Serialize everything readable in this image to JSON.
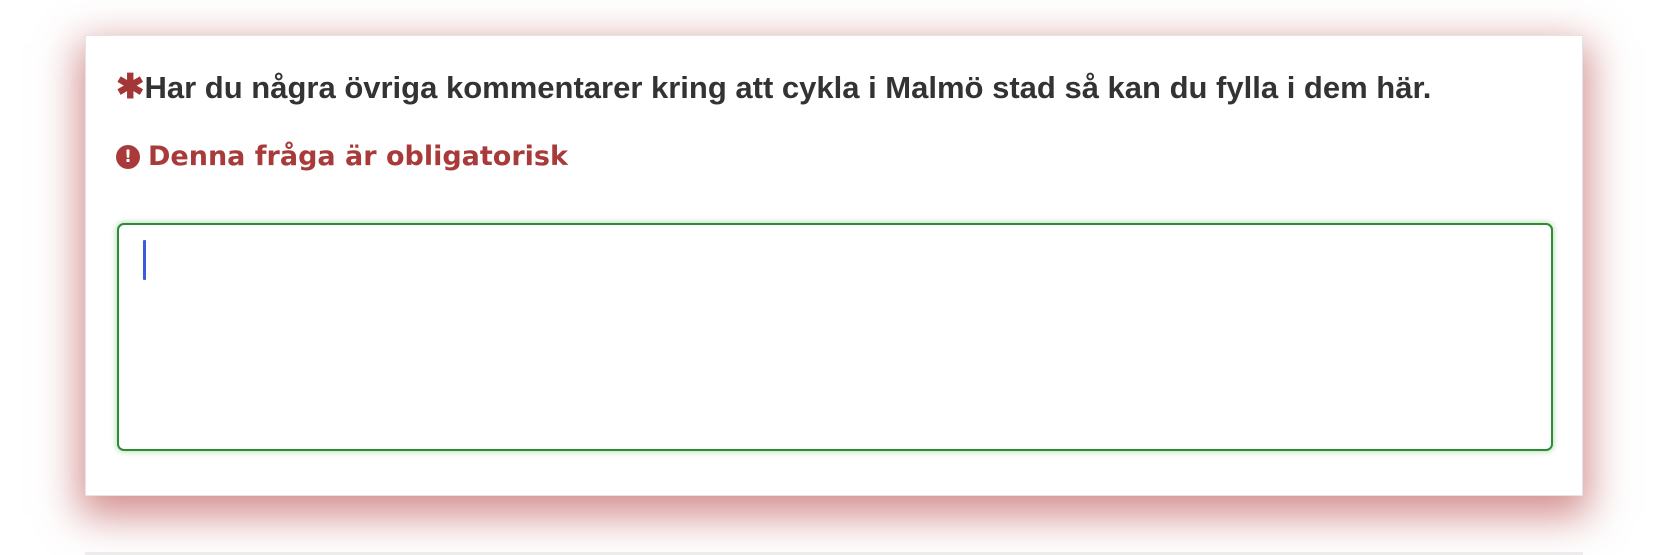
{
  "question": {
    "required_marker": "✱",
    "text": "Har du några övriga kommentarer kring att cykla i Malmö stad så kan du fylla i dem här."
  },
  "validation": {
    "icon": "exclamation-circle-icon",
    "icon_glyph": "!",
    "message": "Denna fråga är obligatorisk"
  },
  "answer": {
    "value": "",
    "placeholder": ""
  },
  "colors": {
    "error": "#a83a3a",
    "focus_border": "#2e8b36",
    "caret": "#3b5bdb",
    "title_text": "#333333"
  }
}
